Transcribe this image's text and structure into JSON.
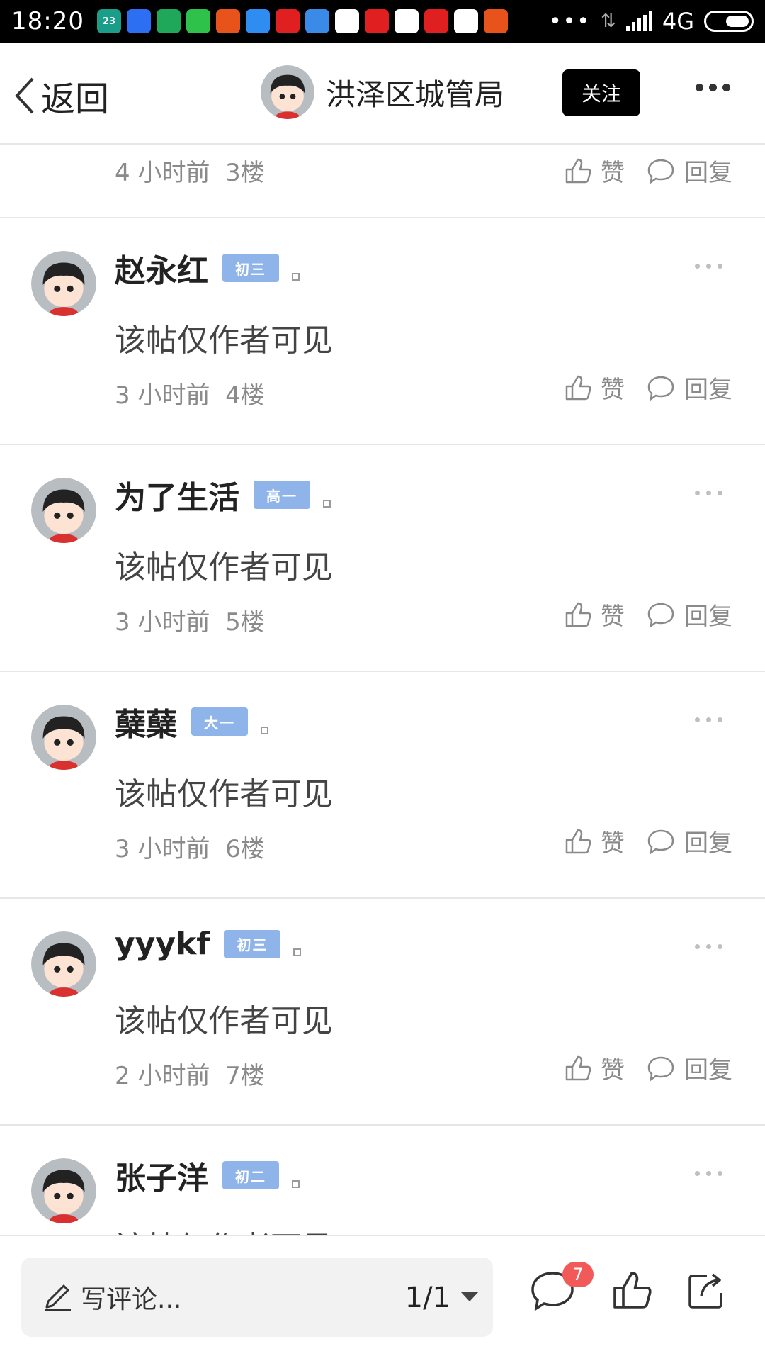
{
  "status_bar": {
    "time": "18:20",
    "calendar_badge": "23",
    "network": "4G",
    "overflow": "•••",
    "app_icons": [
      {
        "name": "calendar-icon",
        "color": "#1a9e8a",
        "text": "23"
      },
      {
        "name": "shield-icon",
        "color": "#2d6ff2",
        "text": ""
      },
      {
        "name": "security-icon",
        "color": "#1fa85a",
        "text": ""
      },
      {
        "name": "wechat-icon",
        "color": "#2fc24a",
        "text": ""
      },
      {
        "name": "promo-app-icon",
        "color": "#e8531c",
        "text": ""
      },
      {
        "name": "app-icon",
        "color": "#2f8cf0",
        "text": ""
      },
      {
        "name": "news-app-icon",
        "color": "#e02020",
        "text": ""
      },
      {
        "name": "app-icon",
        "color": "#3a8ae8",
        "text": ""
      },
      {
        "name": "play-icon",
        "color": "#ffffff",
        "text": ""
      },
      {
        "name": "news-app-icon",
        "color": "#e02020",
        "text": ""
      },
      {
        "name": "play-icon",
        "color": "#ffffff",
        "text": ""
      },
      {
        "name": "news-app-icon",
        "color": "#e02020",
        "text": ""
      },
      {
        "name": "k-app-icon",
        "color": "#ffffff",
        "text": ""
      },
      {
        "name": "promo-app-icon",
        "color": "#e8531c",
        "text": ""
      }
    ]
  },
  "header": {
    "back_label": "返回",
    "title": "洪泽区城管局",
    "follow_label": "关注"
  },
  "partial_post": {
    "time": "4 小时前",
    "floor": "3楼"
  },
  "actions": {
    "like": "赞",
    "reply": "回复"
  },
  "posts": [
    {
      "name": "赵永红",
      "badge": "初三",
      "content": "该帖仅作者可见",
      "time": "3 小时前",
      "floor": "4楼"
    },
    {
      "name": "为了生活",
      "badge": "高一",
      "content": "该帖仅作者可见",
      "time": "3 小时前",
      "floor": "5楼"
    },
    {
      "name": "蘖蘖",
      "badge": "大一",
      "content": "该帖仅作者可见",
      "time": "3 小时前",
      "floor": "6楼"
    },
    {
      "name": "yyykf",
      "badge": "初三",
      "content": "该帖仅作者可见",
      "time": "2 小时前",
      "floor": "7楼"
    },
    {
      "name": "张子洋",
      "badge": "初二",
      "content": "该帖仅作者可见",
      "time": "",
      "floor": ""
    }
  ],
  "bottom_bar": {
    "comment_placeholder": "写评论...",
    "page_indicator": "1/1",
    "comment_count": "7"
  },
  "colors": {
    "badge": "#8fb4ea",
    "follow_button": "#000000",
    "count_badge": "#f25a5a"
  }
}
